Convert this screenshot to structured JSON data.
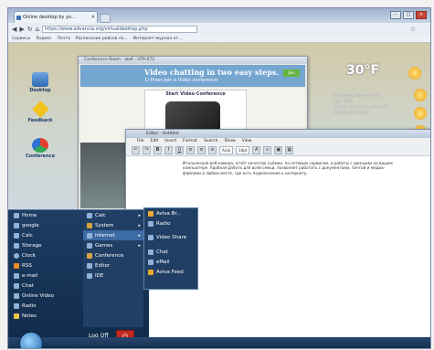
{
  "browser": {
    "tab_title": "Online desktop by yo…",
    "url": "https://www.advancia.org/virtualdesktop.php",
    "bookmarks": [
      "Cервисы",
      "Яндекс",
      "Почта",
      "Расписание рейсов ло...",
      "Интернет-журнал от..."
    ]
  },
  "desktop": {
    "icons": [
      "Desktop",
      "Feedback",
      "Conference"
    ],
    "temperature": "30°F",
    "weather_lines": [
      "Thursday, February 07",
      "New York",
      "Cooler, some sun, shower",
      "Asheroots, storm"
    ]
  },
  "video_window": {
    "title": "Conference Room - wolf - UTA-072",
    "headline": "Video chatting in two easy steps.",
    "subline": "1) Press Join a Video conference",
    "panel_title": "Start Video Conference",
    "button_label": "Join"
  },
  "editor": {
    "title": "Editor - Untitled",
    "menu": [
      "File",
      "Edit",
      "Insert",
      "Format",
      "Search",
      "Show",
      "View"
    ],
    "font": "Arial",
    "size": "10pt",
    "text": "Итальянская веб-камера, отчёт качество съёмки, по сетевым сервисам, и работы с данными на вашем компьютере. Удобная работа для всей семьи, позволяет работать с документами, почтой и медиа-файлами в любом месте, где есть подключение к интернету."
  },
  "start_menu": {
    "left_items": [
      "Home",
      "google",
      "Calc",
      "Storage",
      "Clock",
      "RSS",
      "e-mail",
      "Chat",
      "Online Video",
      "Radio",
      "Notes"
    ],
    "right_items": [
      {
        "label": "Calc",
        "arrow": "▸"
      },
      {
        "label": "System",
        "arrow": "▸"
      },
      {
        "label": "Internet",
        "arrow": "▸"
      },
      {
        "label": "Games",
        "arrow": "▸"
      },
      {
        "label": "Conference",
        "arrow": ""
      },
      {
        "label": "Editor",
        "arrow": ""
      },
      {
        "label": "IDE",
        "arrow": ""
      }
    ],
    "submenu": [
      "Aviva Br...",
      "Radio",
      "Video Share",
      "Chat",
      "eMail",
      "Aviva Feed"
    ],
    "logoff": "Log Off"
  }
}
